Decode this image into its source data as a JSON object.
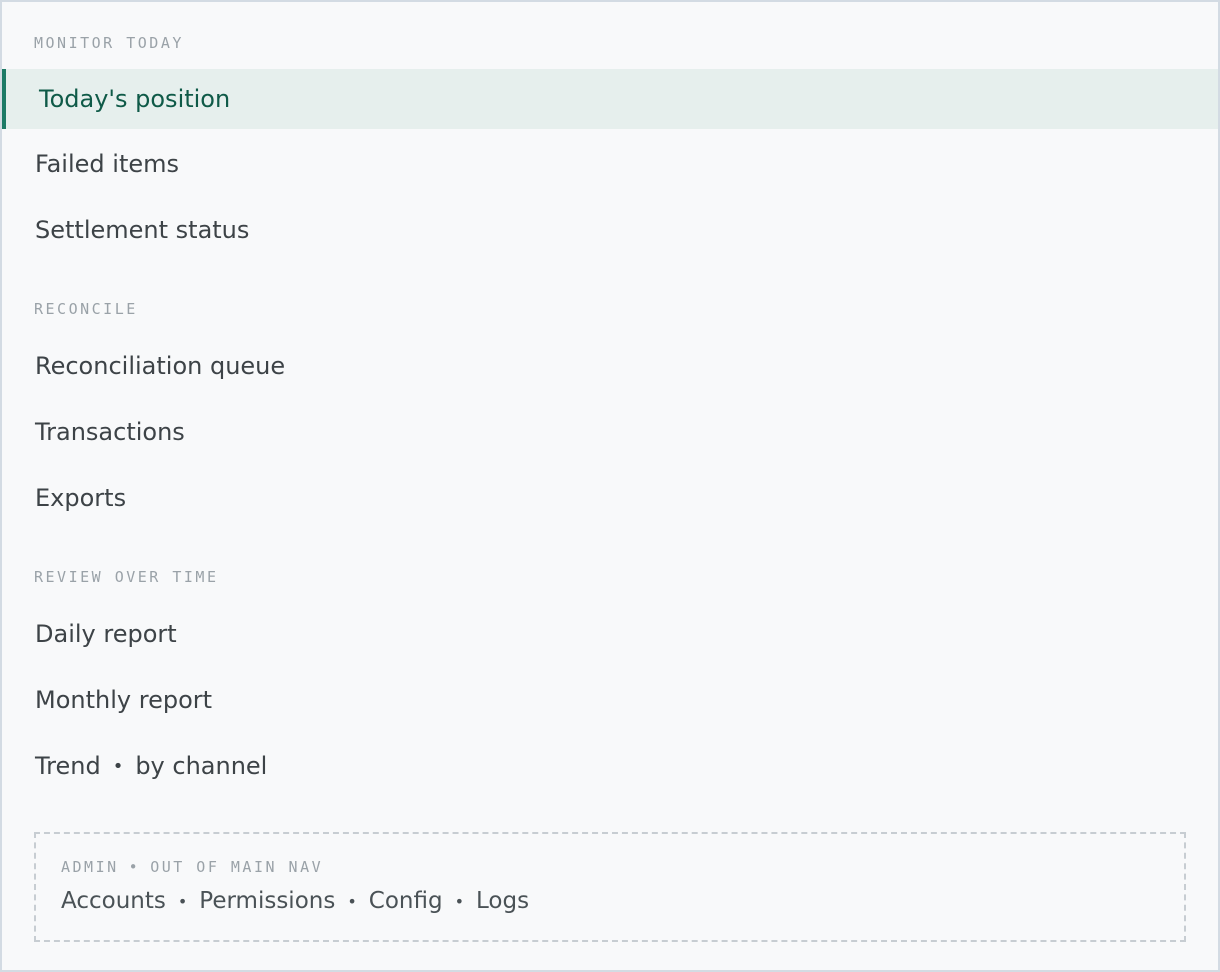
{
  "nav": {
    "sections": [
      {
        "header": "MONITOR TODAY",
        "items": [
          {
            "label": "Today's position",
            "active": true
          },
          {
            "label": "Failed items"
          },
          {
            "label": "Settlement status"
          }
        ]
      },
      {
        "header": "RECONCILE",
        "items": [
          {
            "label": "Reconciliation queue"
          },
          {
            "label": "Transactions"
          },
          {
            "label": "Exports"
          }
        ]
      },
      {
        "header": "REVIEW OVER TIME",
        "items": [
          {
            "label": "Daily report"
          },
          {
            "label": "Monthly report"
          },
          {
            "label": "Trend",
            "suffix": "by channel",
            "separator": "•"
          }
        ]
      }
    ]
  },
  "admin": {
    "header_left": "ADMIN",
    "header_sep": "•",
    "header_right": "OUT OF MAIN NAV",
    "links": [
      "Accounts",
      "Permissions",
      "Config",
      "Logs"
    ],
    "link_sep": "•"
  },
  "colors": {
    "accent": "#1d7a66",
    "active_bg": "#e6efed",
    "background": "#f8f9fa",
    "muted": "#9aa2a8",
    "text": "#3d4347"
  }
}
